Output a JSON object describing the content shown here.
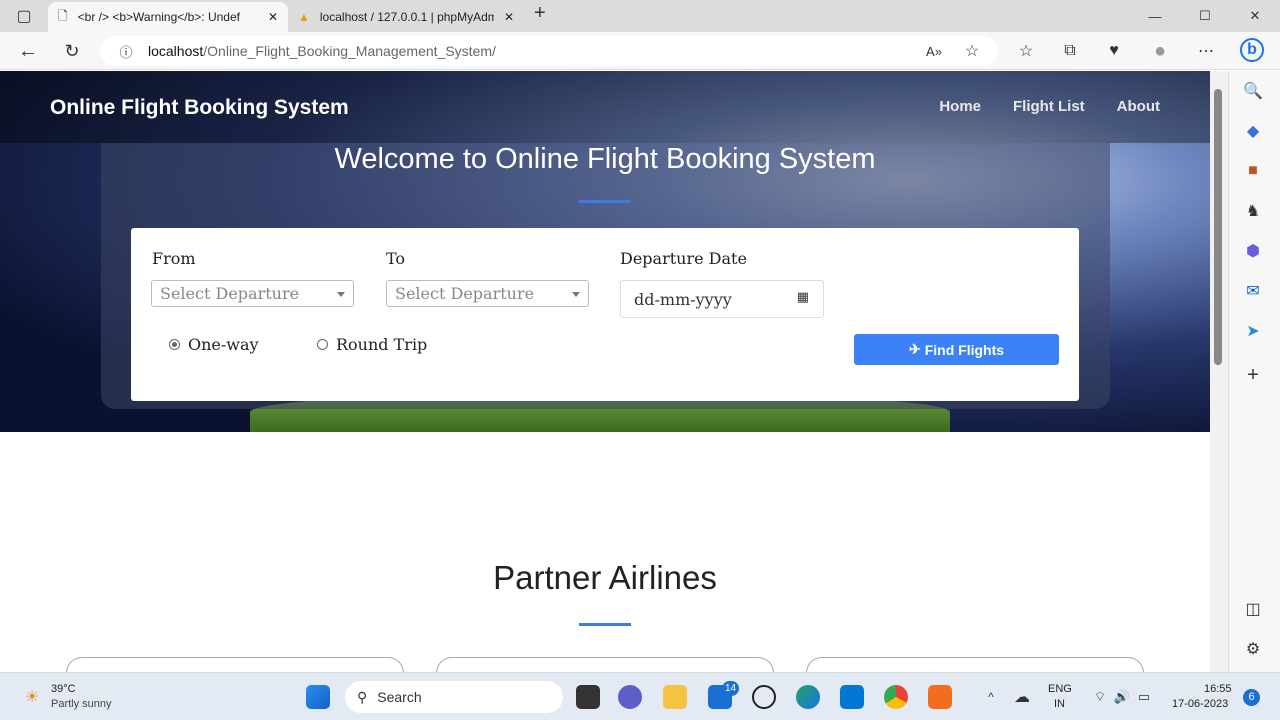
{
  "browser": {
    "tabs": [
      {
        "title": "<br /> <b>Warning</b>: Undef",
        "active": true
      },
      {
        "title": "localhost / 127.0.0.1 | phpMyAdm",
        "active": false
      }
    ],
    "url_host": "localhost",
    "url_path": "/Online_Flight_Booking_Management_System/"
  },
  "site": {
    "brand": "Online Flight Booking System",
    "nav": [
      "Home",
      "Flight List",
      "About"
    ],
    "welcome": "Welcome to Online Flight Booking System",
    "form": {
      "from_label": "From",
      "to_label": "To",
      "date_label": "Departure Date",
      "from_placeholder": "Select Departure",
      "to_placeholder": "Select Departure",
      "date_placeholder": "dd-mm-yyyy",
      "trip_options": [
        "One-way",
        "Round Trip"
      ],
      "selected_trip": "One-way",
      "find_button": "Find Flights"
    },
    "partners_title": "Partner Airlines"
  },
  "taskbar": {
    "weather_temp": "39°C",
    "weather_desc": "Partly sunny",
    "search": "Search",
    "mail_badge": "14",
    "lang1": "ENG",
    "lang2": "IN",
    "time": "16:55",
    "date": "17-06-2023",
    "notifications": "6"
  },
  "colors": {
    "accent": "#3b82f6"
  }
}
